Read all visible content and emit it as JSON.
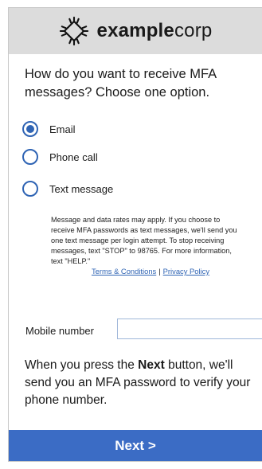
{
  "brand": {
    "name_bold": "example",
    "name_regular": "corp",
    "logo_icon": "chip-icon"
  },
  "question": "How do you want to receive MFA messages? Choose one option.",
  "options": [
    {
      "label": "Email",
      "selected": true
    },
    {
      "label": "Phone call",
      "selected": false
    },
    {
      "label": "Text message",
      "selected": false
    }
  ],
  "disclaimer": "Message and data rates may apply. If you choose to receive MFA passwords as text messages, we'll send you one text message per login attempt. To stop receiving messages, text \"STOP\" to 98765. For more information, text \"HELP.\"",
  "links": {
    "terms": "Terms & Conditions",
    "separator": "|",
    "privacy": "Privacy Policy"
  },
  "mobile": {
    "label": "Mobile number",
    "value": "",
    "placeholder": ""
  },
  "info": {
    "before": "When you press the ",
    "bold": "Next",
    "after": " button, we'll send you an MFA password to verify your phone number."
  },
  "next_button": "Next >",
  "colors": {
    "accent": "#3b6cc5",
    "radio": "#2f64b4",
    "header_bg": "#dcdcdc"
  }
}
